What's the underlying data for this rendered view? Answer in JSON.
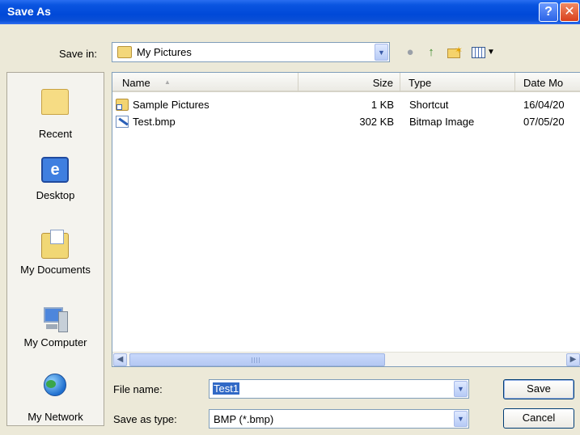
{
  "window": {
    "title": "Save As",
    "help_glyph": "?",
    "close_glyph": "✕"
  },
  "save_in": {
    "label": "Save in:",
    "value": "My Pictures"
  },
  "toolbar": {
    "icons": [
      "back-icon",
      "up-folder-icon",
      "new-folder-icon",
      "views-menu-icon"
    ]
  },
  "places": [
    {
      "label": "Recent",
      "icon": "recent-icon"
    },
    {
      "label": "Desktop",
      "icon": "desktop-icon"
    },
    {
      "label": "My Documents",
      "icon": "my-documents-icon"
    },
    {
      "label": "My Computer",
      "icon": "my-computer-icon"
    },
    {
      "label": "My Network",
      "icon": "my-network-icon"
    }
  ],
  "file_list": {
    "columns": [
      "Name",
      "Size",
      "Type",
      "Date Mo"
    ],
    "sort_column": "Name",
    "rows": [
      {
        "name": "Sample Pictures",
        "size": "1 KB",
        "type": "Shortcut",
        "date": "16/04/20"
      },
      {
        "name": "Test.bmp",
        "size": "302 KB",
        "type": "Bitmap Image",
        "date": "07/05/20"
      }
    ]
  },
  "file_name": {
    "label": "File name:",
    "value": "Test1"
  },
  "save_as_type": {
    "label": "Save as type:",
    "value": "BMP (*.bmp)"
  },
  "buttons": {
    "save": "Save",
    "cancel": "Cancel"
  },
  "colors": {
    "titlebar": "#0049d8",
    "selection": "#3169c6",
    "dialog_bg": "#ECE9D8"
  }
}
